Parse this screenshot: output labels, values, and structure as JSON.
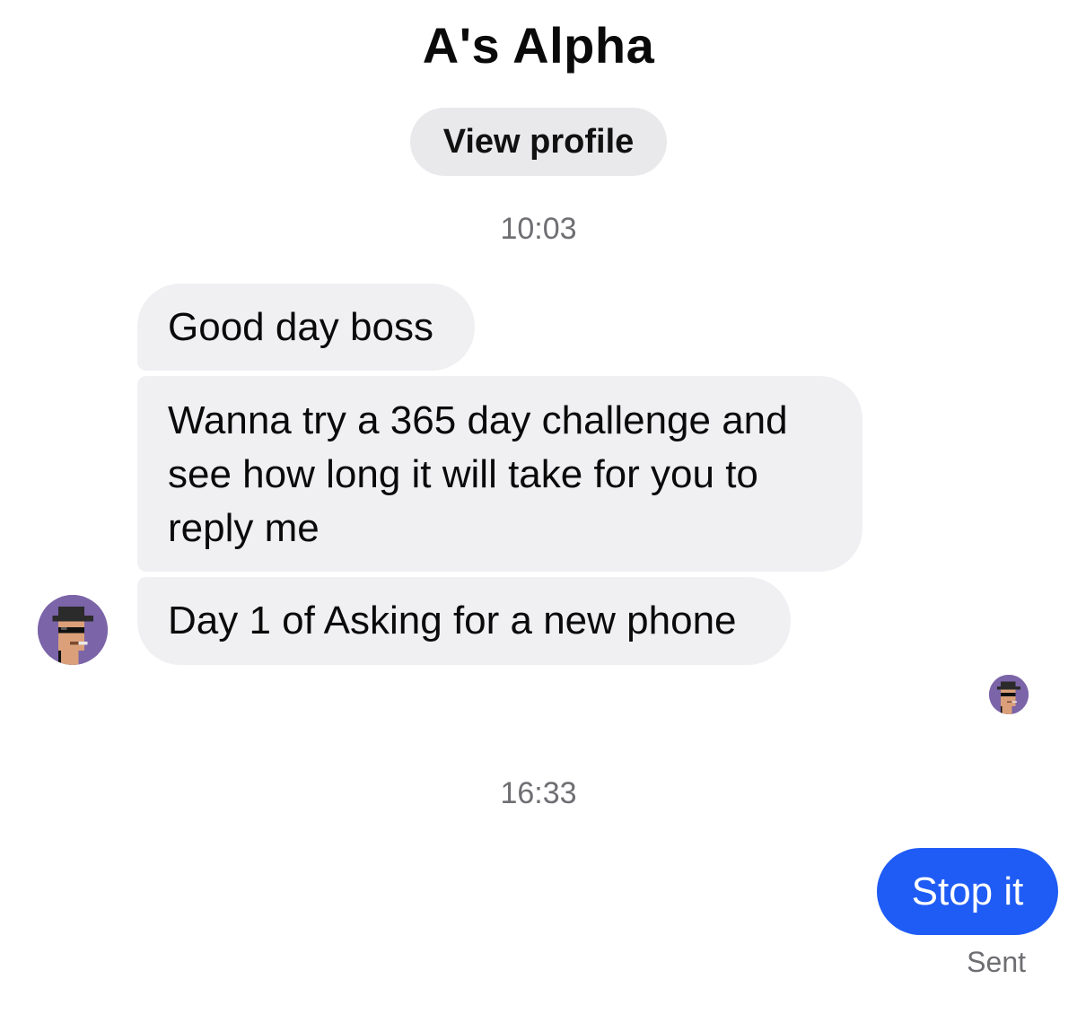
{
  "header": {
    "title": "A's Alpha",
    "view_profile_label": "View profile"
  },
  "timestamps": [
    "10:03",
    "16:33"
  ],
  "incoming_messages": [
    {
      "text": "Good day boss"
    },
    {
      "text": "Wanna try a 365 day challenge and see how long it will take for you to reply me"
    },
    {
      "text": "Day 1 of Asking for a new phone"
    }
  ],
  "outgoing_messages": [
    {
      "text": "Stop it",
      "status": "Sent"
    }
  ],
  "avatar": {
    "icon": "pixel-avatar-hat-sunglasses-icon",
    "background_color": "#7b64a8"
  },
  "colors": {
    "incoming_bubble": "#f0f0f3",
    "outgoing_bubble": "#1f5cf5",
    "secondary_text": "#6e6e73"
  }
}
